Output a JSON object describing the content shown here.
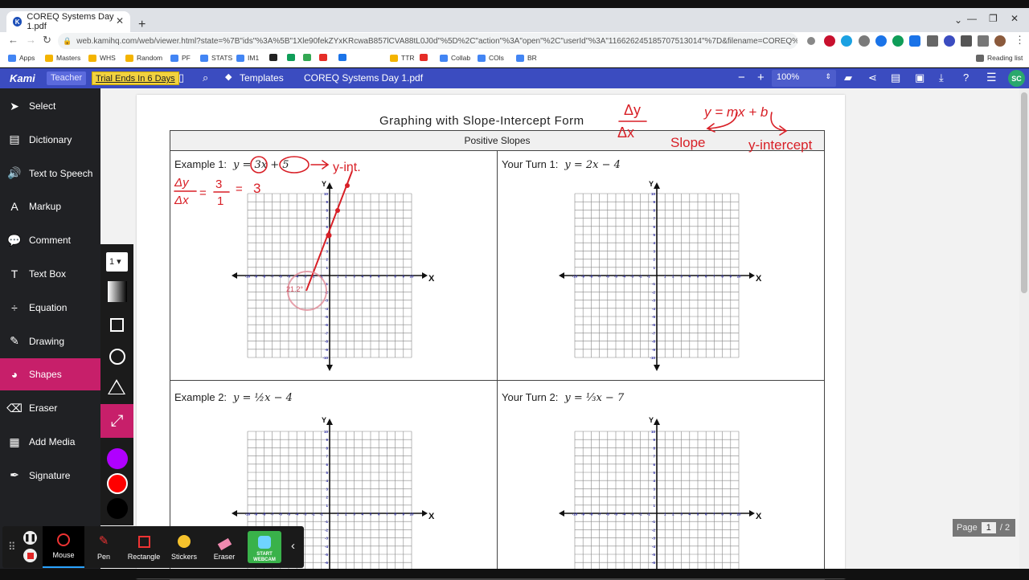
{
  "browser": {
    "tab_title": "COREQ Systems Day 1.pdf",
    "tab_favicon": "K",
    "url": "web.kamihq.com/web/viewer.html?state=%7B\"ids\"%3A%5B\"1Xle90fekZYxKRcwaB857lCVA88tL0J0d\"%5D%2C\"action\"%3A\"open\"%2C\"userId\"%3A\"116626245185707513014\"%7D&filename=COREQ%2...",
    "bookmarks": [
      "Apps",
      "Masters",
      "WHS",
      "Random",
      "PF",
      "STATS",
      "IM1",
      "",
      "",
      "",
      "",
      "",
      "TTR",
      "",
      "Collab",
      "COls",
      "BR"
    ],
    "reading_list": "Reading list"
  },
  "kami": {
    "logo": "Kami",
    "teacher_label": "Teacher",
    "trial_label": "Trial Ends In 6 Days",
    "templates_label": "Templates",
    "document_name": "COREQ Systems Day 1.pdf",
    "zoom": "100%",
    "avatar": "SC"
  },
  "sidebar": {
    "items": [
      {
        "label": "Select",
        "icon": "cursor-icon"
      },
      {
        "label": "Dictionary",
        "icon": "book-icon"
      },
      {
        "label": "Text to Speech",
        "icon": "speech-icon"
      },
      {
        "label": "Markup",
        "icon": "markup-icon"
      },
      {
        "label": "Comment",
        "icon": "comment-icon"
      },
      {
        "label": "Text Box",
        "icon": "text-box-icon"
      },
      {
        "label": "Equation",
        "icon": "equation-icon"
      },
      {
        "label": "Drawing",
        "icon": "pen-icon"
      },
      {
        "label": "Shapes",
        "icon": "shapes-icon"
      },
      {
        "label": "Eraser",
        "icon": "eraser-icon"
      },
      {
        "label": "Add Media",
        "icon": "media-icon"
      },
      {
        "label": "Signature",
        "icon": "signature-icon"
      }
    ],
    "active": "Shapes",
    "active_color": "#c71f6a"
  },
  "shapes_toolbar": {
    "stroke_width": "1",
    "colors": [
      "#b000ff",
      "#ff0000",
      "#000000"
    ]
  },
  "worksheet": {
    "title": "Graphing with Slope-Intercept Form",
    "section": "Positive Slopes",
    "cells": [
      {
        "label": "Example 1:",
        "equation": "y = 3x + 5"
      },
      {
        "label": "Your Turn 1:",
        "equation": "y = 2x − 4"
      },
      {
        "label": "Example 2:",
        "equation": "y = ½x − 4"
      },
      {
        "label": "Your Turn 2:",
        "equation": "y = ⅓x − 7"
      }
    ],
    "axis_x": "X",
    "axis_y": "Y",
    "annotations": {
      "slope_formula": "Δy / Δx",
      "general_form": "y = mx + b",
      "slope_word": "Slope",
      "yint_word": "y-intercept",
      "yint_short": "y-int.",
      "ratio": "Δy/Δx = 3/1 = 3",
      "angle": "21.2°",
      "ink_color": "#d81f26"
    }
  },
  "page_indicator": {
    "label": "Page",
    "current": "1",
    "total": "/ 2"
  },
  "bottom_toolbar": {
    "tools": [
      "Mouse",
      "Pen",
      "Rectangle",
      "Stickers",
      "Eraser",
      "START WEBCAM"
    ]
  }
}
